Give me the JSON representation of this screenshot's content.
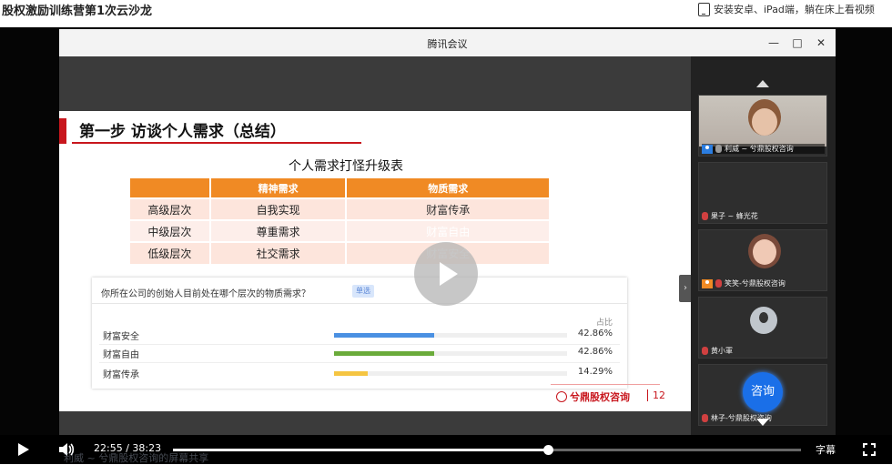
{
  "page": {
    "title": "股权激励训练营第1次云沙龙",
    "install_hint": "安装安卓、iPad端，躺在床上看视频"
  },
  "meeting": {
    "window_title": "腾讯会议",
    "minimize": "—",
    "maximize": "□",
    "close": "✕"
  },
  "slide": {
    "heading": "第一步 访谈个人需求（总结）",
    "table_title": "个人需求打怪升级表",
    "table": {
      "headers": [
        "",
        "精神需求",
        "物质需求"
      ],
      "rows": [
        [
          "高级层次",
          "自我实现",
          "财富传承"
        ],
        [
          "中级层次",
          "尊重需求",
          "财富自由"
        ],
        [
          "低级层次",
          "社交需求",
          "财富安全"
        ]
      ]
    },
    "poll": {
      "question": "你所在公司的创始人目前处在哪个层次的物质需求？",
      "tag": "单选",
      "column_header": "占比",
      "options": [
        {
          "label": "财富安全",
          "percent": "42.86%",
          "fraction": 0.4286,
          "color": "#4a90e2"
        },
        {
          "label": "财富自由",
          "percent": "42.86%",
          "fraction": 0.4286,
          "color": "#6aab3a"
        },
        {
          "label": "财富传承",
          "percent": "14.29%",
          "fraction": 0.1429,
          "color": "#f5c542"
        }
      ]
    },
    "logo_text": "兮鼎股权咨询",
    "page_number": "12"
  },
  "participants": [
    {
      "name": "利威 ~ 兮鼎股权咨询"
    },
    {
      "name": "果子 ~ 蜂光花"
    },
    {
      "name": "笑笑-兮鼎股权咨询"
    },
    {
      "name": "黄小軍"
    },
    {
      "name": "林子-兮鼎股权咨询",
      "badge": "咨询"
    }
  ],
  "player": {
    "current_time": "22:55",
    "separator": "/",
    "duration": "38:23",
    "progress_fraction": 0.597,
    "subtitle_label": "字幕",
    "share_status": "利威 ~ 兮鼎股权咨询的屏幕共享"
  }
}
